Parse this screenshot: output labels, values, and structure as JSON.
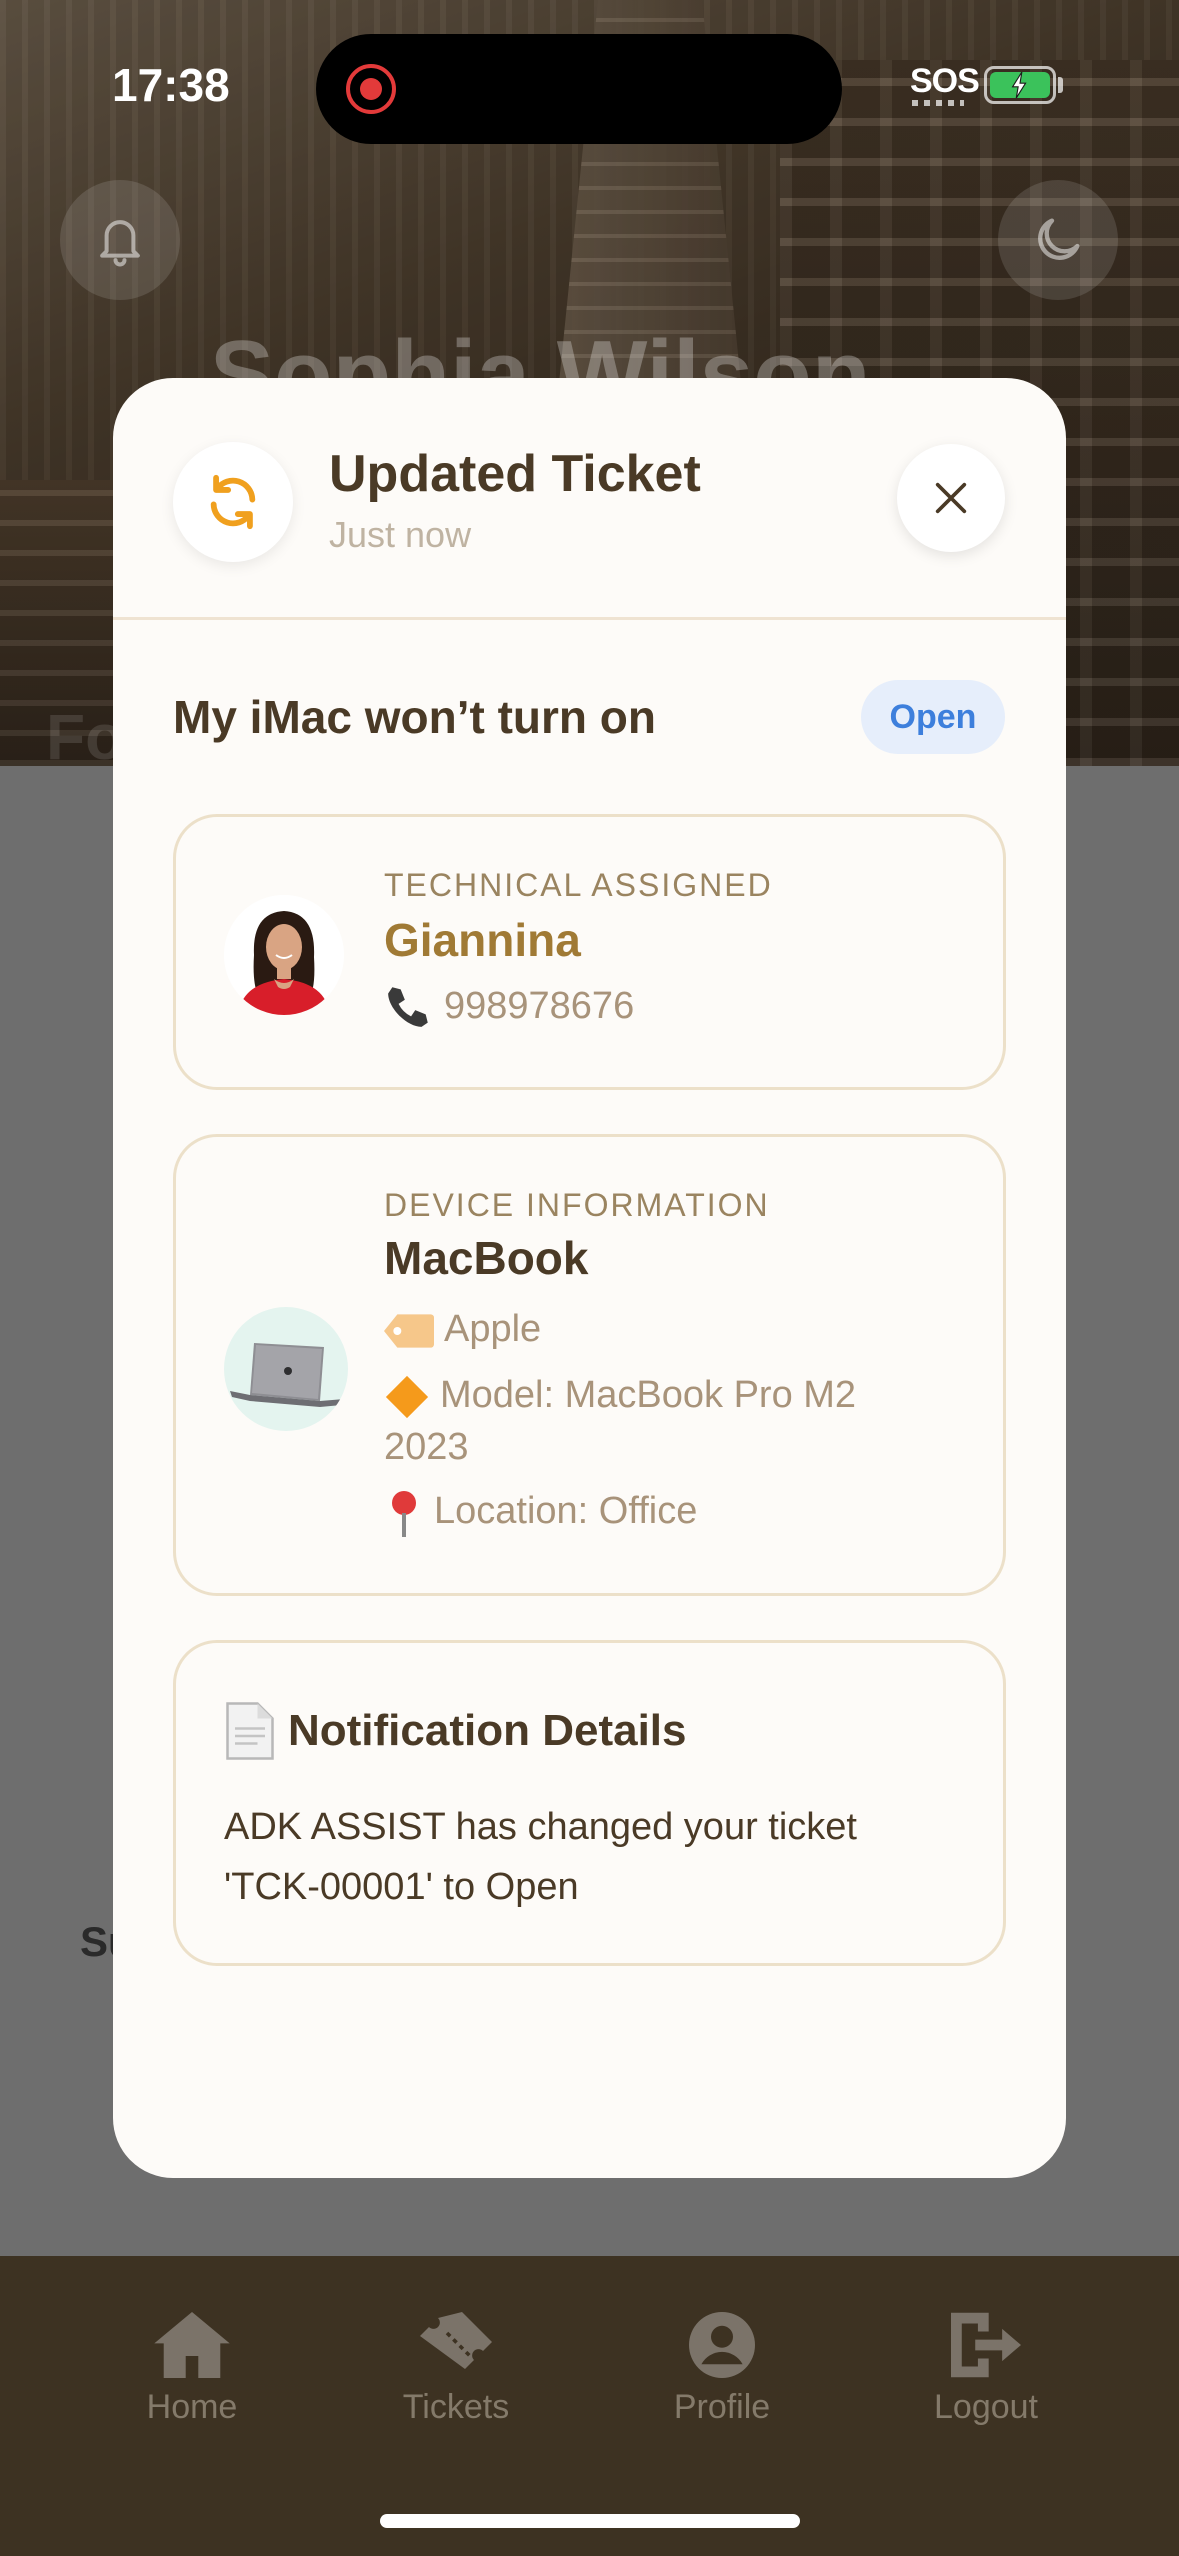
{
  "status_bar": {
    "time": "17:38",
    "sos": "SOS"
  },
  "background": {
    "user_name": "Sophia Wilson",
    "partial_left_heading": "Fo",
    "partial_side_label": "Su"
  },
  "bottom_nav": {
    "items": [
      {
        "label": "Home",
        "icon": "home-icon"
      },
      {
        "label": "Tickets",
        "icon": "ticket-icon"
      },
      {
        "label": "Profile",
        "icon": "profile-icon"
      },
      {
        "label": "Logout",
        "icon": "logout-icon"
      }
    ]
  },
  "modal": {
    "title": "Updated Ticket",
    "subtitle": "Just now",
    "ticket_title": "My iMac won’t turn on",
    "status": "Open",
    "technician": {
      "label": "TECHNICAL ASSIGNED",
      "name": "Giannina",
      "phone": "998978676"
    },
    "device": {
      "label": "DEVICE INFORMATION",
      "name": "MacBook",
      "brand": "Apple",
      "model": "Model: MacBook Pro M2 2023",
      "location": "Location: Office"
    },
    "notification": {
      "title": "Notification Details",
      "body": "ADK ASSIST has changed your ticket 'TCK-00001' to Open"
    }
  },
  "colors": {
    "accent_orange": "#f0a01e",
    "status_blue": "#3d7fdc",
    "nav_bg": "#3d3222",
    "title_brown": "#4a3a26"
  }
}
